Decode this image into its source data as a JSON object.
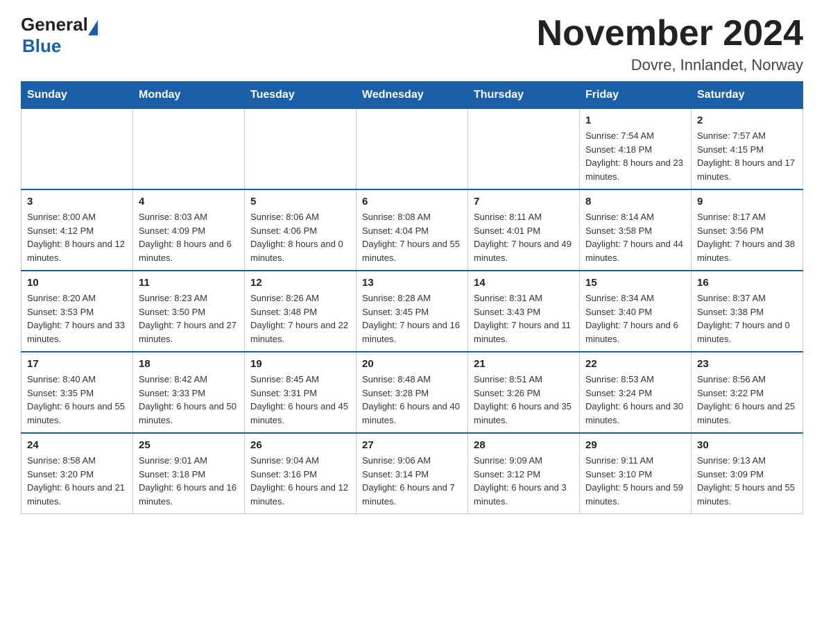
{
  "header": {
    "logo_general": "General",
    "logo_blue": "Blue",
    "month_title": "November 2024",
    "location": "Dovre, Innlandet, Norway"
  },
  "calendar": {
    "days_of_week": [
      "Sunday",
      "Monday",
      "Tuesday",
      "Wednesday",
      "Thursday",
      "Friday",
      "Saturday"
    ],
    "weeks": [
      [
        {
          "day": "",
          "info": ""
        },
        {
          "day": "",
          "info": ""
        },
        {
          "day": "",
          "info": ""
        },
        {
          "day": "",
          "info": ""
        },
        {
          "day": "",
          "info": ""
        },
        {
          "day": "1",
          "info": "Sunrise: 7:54 AM\nSunset: 4:18 PM\nDaylight: 8 hours and 23 minutes."
        },
        {
          "day": "2",
          "info": "Sunrise: 7:57 AM\nSunset: 4:15 PM\nDaylight: 8 hours and 17 minutes."
        }
      ],
      [
        {
          "day": "3",
          "info": "Sunrise: 8:00 AM\nSunset: 4:12 PM\nDaylight: 8 hours and 12 minutes."
        },
        {
          "day": "4",
          "info": "Sunrise: 8:03 AM\nSunset: 4:09 PM\nDaylight: 8 hours and 6 minutes."
        },
        {
          "day": "5",
          "info": "Sunrise: 8:06 AM\nSunset: 4:06 PM\nDaylight: 8 hours and 0 minutes."
        },
        {
          "day": "6",
          "info": "Sunrise: 8:08 AM\nSunset: 4:04 PM\nDaylight: 7 hours and 55 minutes."
        },
        {
          "day": "7",
          "info": "Sunrise: 8:11 AM\nSunset: 4:01 PM\nDaylight: 7 hours and 49 minutes."
        },
        {
          "day": "8",
          "info": "Sunrise: 8:14 AM\nSunset: 3:58 PM\nDaylight: 7 hours and 44 minutes."
        },
        {
          "day": "9",
          "info": "Sunrise: 8:17 AM\nSunset: 3:56 PM\nDaylight: 7 hours and 38 minutes."
        }
      ],
      [
        {
          "day": "10",
          "info": "Sunrise: 8:20 AM\nSunset: 3:53 PM\nDaylight: 7 hours and 33 minutes."
        },
        {
          "day": "11",
          "info": "Sunrise: 8:23 AM\nSunset: 3:50 PM\nDaylight: 7 hours and 27 minutes."
        },
        {
          "day": "12",
          "info": "Sunrise: 8:26 AM\nSunset: 3:48 PM\nDaylight: 7 hours and 22 minutes."
        },
        {
          "day": "13",
          "info": "Sunrise: 8:28 AM\nSunset: 3:45 PM\nDaylight: 7 hours and 16 minutes."
        },
        {
          "day": "14",
          "info": "Sunrise: 8:31 AM\nSunset: 3:43 PM\nDaylight: 7 hours and 11 minutes."
        },
        {
          "day": "15",
          "info": "Sunrise: 8:34 AM\nSunset: 3:40 PM\nDaylight: 7 hours and 6 minutes."
        },
        {
          "day": "16",
          "info": "Sunrise: 8:37 AM\nSunset: 3:38 PM\nDaylight: 7 hours and 0 minutes."
        }
      ],
      [
        {
          "day": "17",
          "info": "Sunrise: 8:40 AM\nSunset: 3:35 PM\nDaylight: 6 hours and 55 minutes."
        },
        {
          "day": "18",
          "info": "Sunrise: 8:42 AM\nSunset: 3:33 PM\nDaylight: 6 hours and 50 minutes."
        },
        {
          "day": "19",
          "info": "Sunrise: 8:45 AM\nSunset: 3:31 PM\nDaylight: 6 hours and 45 minutes."
        },
        {
          "day": "20",
          "info": "Sunrise: 8:48 AM\nSunset: 3:28 PM\nDaylight: 6 hours and 40 minutes."
        },
        {
          "day": "21",
          "info": "Sunrise: 8:51 AM\nSunset: 3:26 PM\nDaylight: 6 hours and 35 minutes."
        },
        {
          "day": "22",
          "info": "Sunrise: 8:53 AM\nSunset: 3:24 PM\nDaylight: 6 hours and 30 minutes."
        },
        {
          "day": "23",
          "info": "Sunrise: 8:56 AM\nSunset: 3:22 PM\nDaylight: 6 hours and 25 minutes."
        }
      ],
      [
        {
          "day": "24",
          "info": "Sunrise: 8:58 AM\nSunset: 3:20 PM\nDaylight: 6 hours and 21 minutes."
        },
        {
          "day": "25",
          "info": "Sunrise: 9:01 AM\nSunset: 3:18 PM\nDaylight: 6 hours and 16 minutes."
        },
        {
          "day": "26",
          "info": "Sunrise: 9:04 AM\nSunset: 3:16 PM\nDaylight: 6 hours and 12 minutes."
        },
        {
          "day": "27",
          "info": "Sunrise: 9:06 AM\nSunset: 3:14 PM\nDaylight: 6 hours and 7 minutes."
        },
        {
          "day": "28",
          "info": "Sunrise: 9:09 AM\nSunset: 3:12 PM\nDaylight: 6 hours and 3 minutes."
        },
        {
          "day": "29",
          "info": "Sunrise: 9:11 AM\nSunset: 3:10 PM\nDaylight: 5 hours and 59 minutes."
        },
        {
          "day": "30",
          "info": "Sunrise: 9:13 AM\nSunset: 3:09 PM\nDaylight: 5 hours and 55 minutes."
        }
      ]
    ]
  }
}
